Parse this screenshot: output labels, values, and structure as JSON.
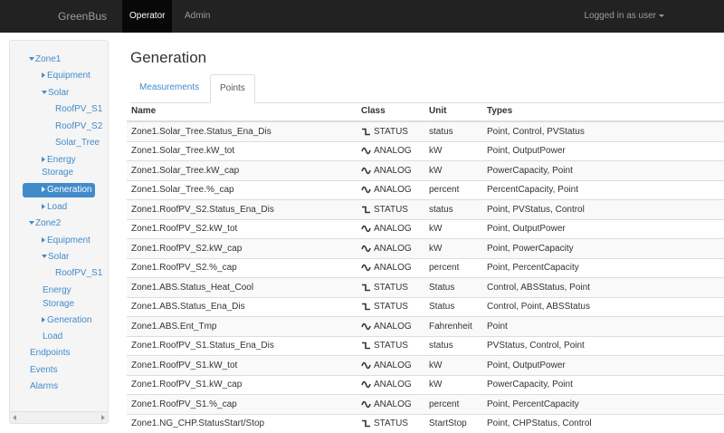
{
  "navbar": {
    "brand": "GreenBus",
    "tabs": [
      {
        "label": "Operator"
      },
      {
        "label": "Admin"
      }
    ],
    "user_menu": "Logged in as user"
  },
  "sidebar": {
    "items": [
      {
        "label": "Zone1",
        "icon": "caret-down-icon"
      },
      {
        "label": "Equipment",
        "icon": "caret-right-icon"
      },
      {
        "label": "Solar",
        "icon": "caret-down-icon"
      },
      {
        "label": "RoofPV_S1"
      },
      {
        "label": "RoofPV_S2"
      },
      {
        "label": "Solar_Tree"
      },
      {
        "label": "Energy",
        "icon": "caret-right-icon"
      },
      {
        "label": "Storage"
      },
      {
        "label": "Generation",
        "icon": "caret-right-icon",
        "active": true
      },
      {
        "label": "Load",
        "icon": "caret-right-icon"
      },
      {
        "label": "Zone2",
        "icon": "caret-down-icon"
      },
      {
        "label": "Equipment",
        "icon": "caret-right-icon"
      },
      {
        "label": "Solar",
        "icon": "caret-down-icon"
      },
      {
        "label": "RoofPV_S1"
      },
      {
        "label": "Energy"
      },
      {
        "label": "Storage"
      },
      {
        "label": "Generation",
        "icon": "caret-right-icon"
      },
      {
        "label": "Load"
      },
      {
        "label": "Endpoints"
      },
      {
        "label": "Events"
      },
      {
        "label": "Alarms"
      }
    ]
  },
  "main": {
    "title": "Generation",
    "tabs": [
      {
        "label": "Measurements"
      },
      {
        "label": "Points",
        "active": true
      }
    ],
    "table": {
      "headers": [
        "Name",
        "Class",
        "Unit",
        "Types"
      ],
      "rows": [
        {
          "name": "Zone1.Solar_Tree.Status_Ena_Dis",
          "class": "STATUS",
          "unit": "status",
          "types": "Point, Control, PVStatus"
        },
        {
          "name": "Zone1.Solar_Tree.kW_tot",
          "class": "ANALOG",
          "unit": "kW",
          "types": "Point, OutputPower"
        },
        {
          "name": "Zone1.Solar_Tree.kW_cap",
          "class": "ANALOG",
          "unit": "kW",
          "types": "PowerCapacity, Point"
        },
        {
          "name": "Zone1.Solar_Tree.%_cap",
          "class": "ANALOG",
          "unit": "percent",
          "types": "PercentCapacity, Point"
        },
        {
          "name": "Zone1.RoofPV_S2.Status_Ena_Dis",
          "class": "STATUS",
          "unit": "status",
          "types": "Point, PVStatus, Control"
        },
        {
          "name": "Zone1.RoofPV_S2.kW_tot",
          "class": "ANALOG",
          "unit": "kW",
          "types": "Point, OutputPower"
        },
        {
          "name": "Zone1.RoofPV_S2.kW_cap",
          "class": "ANALOG",
          "unit": "kW",
          "types": "Point, PowerCapacity"
        },
        {
          "name": "Zone1.RoofPV_S2.%_cap",
          "class": "ANALOG",
          "unit": "percent",
          "types": "Point, PercentCapacity"
        },
        {
          "name": "Zone1.ABS.Status_Heat_Cool",
          "class": "STATUS",
          "unit": "Status",
          "types": "Control, ABSStatus, Point"
        },
        {
          "name": "Zone1.ABS.Status_Ena_Dis",
          "class": "STATUS",
          "unit": "Status",
          "types": "Control, Point, ABSStatus"
        },
        {
          "name": "Zone1.ABS.Ent_Tmp",
          "class": "ANALOG",
          "unit": "Fahrenheit",
          "types": "Point"
        },
        {
          "name": "Zone1.RoofPV_S1.Status_Ena_Dis",
          "class": "STATUS",
          "unit": "status",
          "types": "PVStatus, Control, Point"
        },
        {
          "name": "Zone1.RoofPV_S1.kW_tot",
          "class": "ANALOG",
          "unit": "kW",
          "types": "Point, OutputPower"
        },
        {
          "name": "Zone1.RoofPV_S1.kW_cap",
          "class": "ANALOG",
          "unit": "kW",
          "types": "PowerCapacity, Point"
        },
        {
          "name": "Zone1.RoofPV_S1.%_cap",
          "class": "ANALOG",
          "unit": "percent",
          "types": "Point, PercentCapacity"
        },
        {
          "name": "Zone1.NG_CHP.StatusStart/Stop",
          "class": "STATUS",
          "unit": "StartStop",
          "types": "Point, CHPStatus, Control"
        }
      ]
    }
  }
}
